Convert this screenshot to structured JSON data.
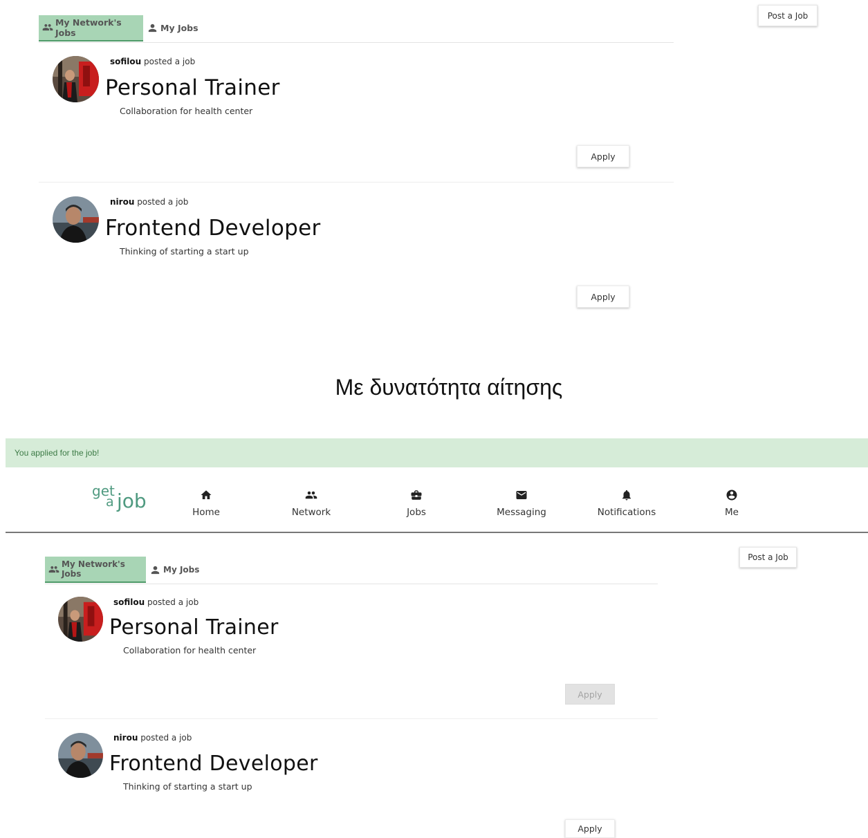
{
  "top": {
    "tabs": [
      {
        "label": "My Network's Jobs",
        "icon": "people-icon",
        "active": true
      },
      {
        "label": "My Jobs",
        "icon": "person-icon",
        "active": false
      }
    ],
    "post_job_label": "Post a Job",
    "jobs": [
      {
        "poster": "sofilou",
        "poster_suffix": " posted a job",
        "title": "Personal Trainer",
        "description": "Collaboration for health center",
        "apply_label": "Apply"
      },
      {
        "poster": "nirou",
        "poster_suffix": " posted a job",
        "title": "Frontend Developer",
        "description": "Thinking of starting a start up",
        "apply_label": "Apply"
      }
    ]
  },
  "caption": "Με δυνατότητα αίτησης",
  "alert": "You applied for the job!",
  "logo": {
    "line1": "get",
    "line2a": "a",
    "line2b": "job"
  },
  "nav": [
    {
      "label": "Home",
      "icon": "home-icon"
    },
    {
      "label": "Network",
      "icon": "people-icon"
    },
    {
      "label": "Jobs",
      "icon": "briefcase-icon"
    },
    {
      "label": "Messaging",
      "icon": "envelope-icon"
    },
    {
      "label": "Notifications",
      "icon": "bell-icon"
    },
    {
      "label": "Me",
      "icon": "account-circle-icon"
    }
  ],
  "bottom": {
    "tabs": [
      {
        "label": "My Network's Jobs",
        "icon": "people-icon",
        "active": true
      },
      {
        "label": "My Jobs",
        "icon": "person-icon",
        "active": false
      }
    ],
    "post_job_label": "Post a Job",
    "jobs": [
      {
        "poster": "sofilou",
        "poster_suffix": " posted a job",
        "title": "Personal Trainer",
        "description": "Collaboration for health center",
        "apply_label": "Apply",
        "applied": true
      },
      {
        "poster": "nirou",
        "poster_suffix": " posted a job",
        "title": "Frontend Developer",
        "description": "Thinking of starting a start up",
        "apply_label": "Apply",
        "applied": false
      }
    ]
  },
  "colors": {
    "accent_tab": "#a8d5b5",
    "alert_bg": "#d6ecd8",
    "alert_text": "#3c7a45",
    "logo": "#4f9a80"
  }
}
